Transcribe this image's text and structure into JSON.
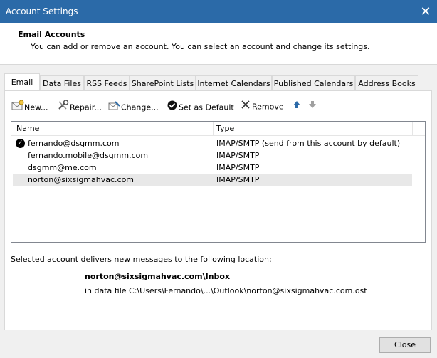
{
  "window": {
    "title": "Account Settings",
    "close_glyph": "✕"
  },
  "header": {
    "title": "Email Accounts",
    "description": "You can add or remove an account. You can select an account and change its settings."
  },
  "tabs": [
    {
      "label": "Email",
      "active": true
    },
    {
      "label": "Data Files"
    },
    {
      "label": "RSS Feeds"
    },
    {
      "label": "SharePoint Lists"
    },
    {
      "label": "Internet Calendars"
    },
    {
      "label": "Published Calendars"
    },
    {
      "label": "Address Books"
    }
  ],
  "toolbar": {
    "new_label": "New...",
    "repair_label": "Repair...",
    "change_label": "Change...",
    "set_default_label": "Set as Default",
    "remove_label": "Remove"
  },
  "list": {
    "columns": {
      "name": "Name",
      "type": "Type"
    },
    "rows": [
      {
        "name": "fernando@dsgmm.com",
        "type": "IMAP/SMTP (send from this account by default)",
        "default": true
      },
      {
        "name": "fernando.mobile@dsgmm.com",
        "type": "IMAP/SMTP"
      },
      {
        "name": "dsgmm@me.com",
        "type": "IMAP/SMTP"
      },
      {
        "name": "norton@sixsigmahvac.com",
        "type": "IMAP/SMTP",
        "selected": true
      }
    ]
  },
  "location": {
    "label": "Selected account delivers new messages to the following location:",
    "folder": "norton@sixsigmahvac.com\\Inbox",
    "data_file": "in data file C:\\Users\\Fernando\\...\\Outlook\\norton@sixsigmahvac.com.ost"
  },
  "buttons": {
    "close_label": "Close"
  },
  "colors": {
    "titlebar": "#2b6aa8",
    "background": "#f0f0f0",
    "selected_row": "#e8e8e8"
  }
}
